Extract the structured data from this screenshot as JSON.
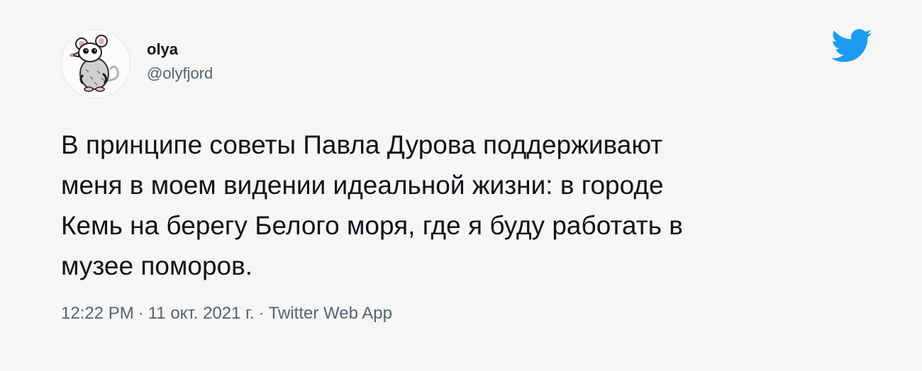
{
  "author": {
    "display_name": "olya",
    "handle": "@olyfjord",
    "avatar_icon": "opossum-avatar-icon"
  },
  "brand": {
    "icon": "twitter-bird-icon",
    "color": "#1d9bf0"
  },
  "tweet": {
    "lines": [
      "В принципе советы Павла Дурова поддерживают",
      "меня в моем видении идеальной жизни: в городе",
      "Кемь на берегу Белого моря, где я буду работать в",
      "музее поморов."
    ]
  },
  "meta": {
    "time": "12:22 PM",
    "date": "11 окт. 2021 г.",
    "source": "Twitter Web App",
    "separator": "·"
  }
}
